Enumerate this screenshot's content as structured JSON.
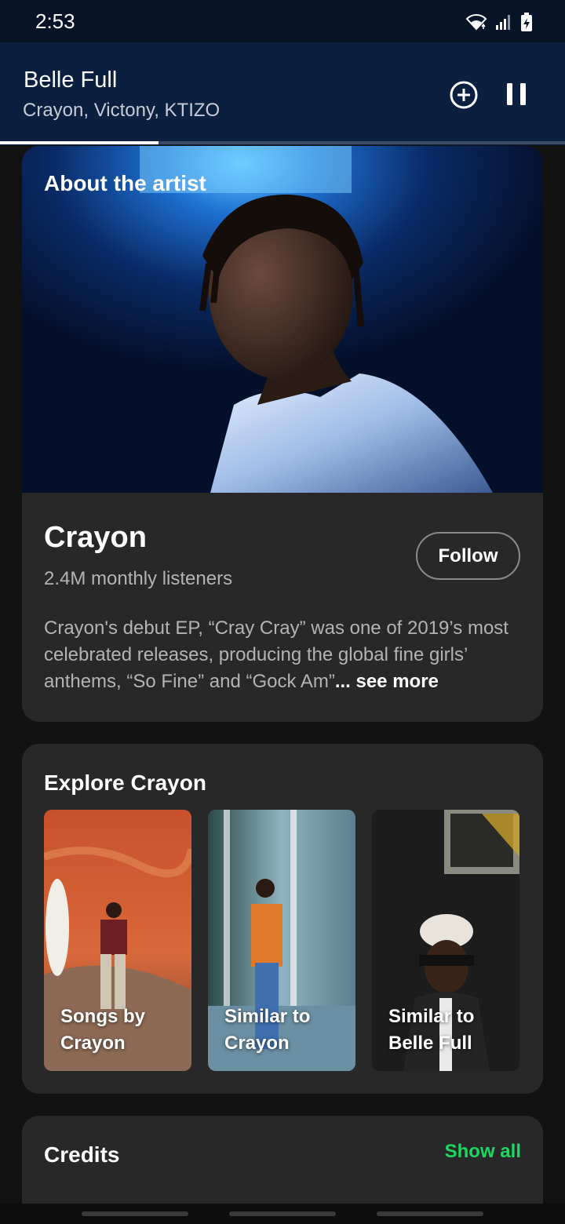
{
  "status_bar": {
    "time": "2:53",
    "icons": [
      "wifi-icon",
      "signal-icon",
      "battery-charging-icon"
    ]
  },
  "now_playing": {
    "title": "Belle Full",
    "artists": "Crayon, Victony, KTIZO",
    "progress_fraction": 0.28,
    "icons": [
      "add-circle-icon",
      "pause-icon"
    ]
  },
  "about": {
    "heading": "About the artist",
    "artist_name": "Crayon",
    "monthly_listeners": "2.4M monthly listeners",
    "follow_label": "Follow",
    "bio": "Crayon's debut EP, “Cray Cray” was one of 2019’s most celebrated releases, producing the global fine girls’ anthems, “So Fine” and “Gock Am”",
    "see_more": "... see more"
  },
  "explore": {
    "heading": "Explore Crayon",
    "tiles": [
      {
        "label": "Songs by Crayon"
      },
      {
        "label": "Similar to Crayon"
      },
      {
        "label": "Similar to Belle Full"
      }
    ]
  },
  "credits": {
    "heading": "Credits",
    "show_all": "Show all"
  },
  "colors": {
    "background": "#121212",
    "card": "#282828",
    "header": "#0b1f3e",
    "accent_green": "#1ed760",
    "secondary_text": "#b3b3b3"
  }
}
